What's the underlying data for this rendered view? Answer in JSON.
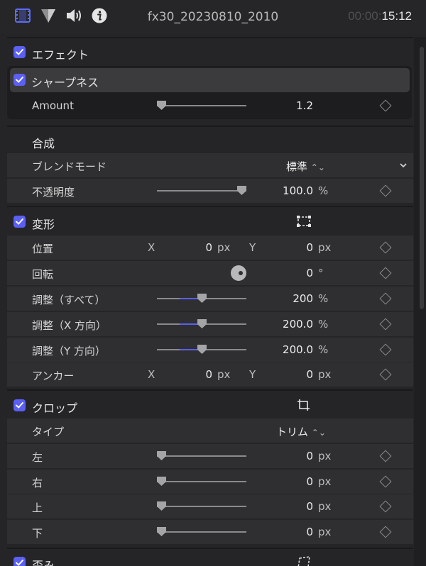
{
  "top_bar": {
    "icons": [
      "film-strip-icon",
      "funnel-triangle-icon",
      "speaker-icon",
      "info-icon"
    ],
    "clip_name": "fx30_20230810_2010",
    "timecode_dim": "00:00:",
    "timecode_lit": "15:12"
  },
  "effects": {
    "label": "エフェクト",
    "sharpness": {
      "label": "シャープネス",
      "amount_label": "Amount",
      "amount_value": "1.2",
      "amount_fraction": 0.0
    }
  },
  "compositing": {
    "label": "合成",
    "blend_mode_label": "ブレンドモード",
    "blend_mode_value": "標準",
    "opacity_label": "不透明度",
    "opacity_value": "100.0",
    "opacity_unit": "%",
    "opacity_fraction": 1.0
  },
  "transform": {
    "label": "変形",
    "position": {
      "label": "位置",
      "x_label": "X",
      "x_value": "0",
      "x_unit": "px",
      "y_label": "Y",
      "y_value": "0",
      "y_unit": "px"
    },
    "rotation": {
      "label": "回転",
      "value": "0",
      "unit": "°"
    },
    "scale_all": {
      "label": "調整（すべて）",
      "value": "200",
      "unit": "%",
      "fraction": 0.5
    },
    "scale_x": {
      "label": "調整（X 方向）",
      "value": "200.0",
      "unit": "%",
      "fraction": 0.5
    },
    "scale_y": {
      "label": "調整（Y 方向）",
      "value": "200.0",
      "unit": "%",
      "fraction": 0.5
    },
    "anchor": {
      "label": "アンカー",
      "x_label": "X",
      "x_value": "0",
      "x_unit": "px",
      "y_label": "Y",
      "y_value": "0",
      "y_unit": "px"
    }
  },
  "crop": {
    "label": "クロップ",
    "type_label": "タイプ",
    "type_value": "トリム",
    "left": {
      "label": "左",
      "value": "0",
      "unit": "px",
      "fraction": 0.0
    },
    "right": {
      "label": "右",
      "value": "0",
      "unit": "px",
      "fraction": 0.0
    },
    "top": {
      "label": "上",
      "value": "0",
      "unit": "px",
      "fraction": 0.0
    },
    "bottom": {
      "label": "下",
      "value": "0",
      "unit": "px",
      "fraction": 0.0
    }
  },
  "distort": {
    "label": "歪み"
  },
  "colors": {
    "accent": "#5b5ff2",
    "background": "#252527",
    "row": "#2f2f31"
  }
}
